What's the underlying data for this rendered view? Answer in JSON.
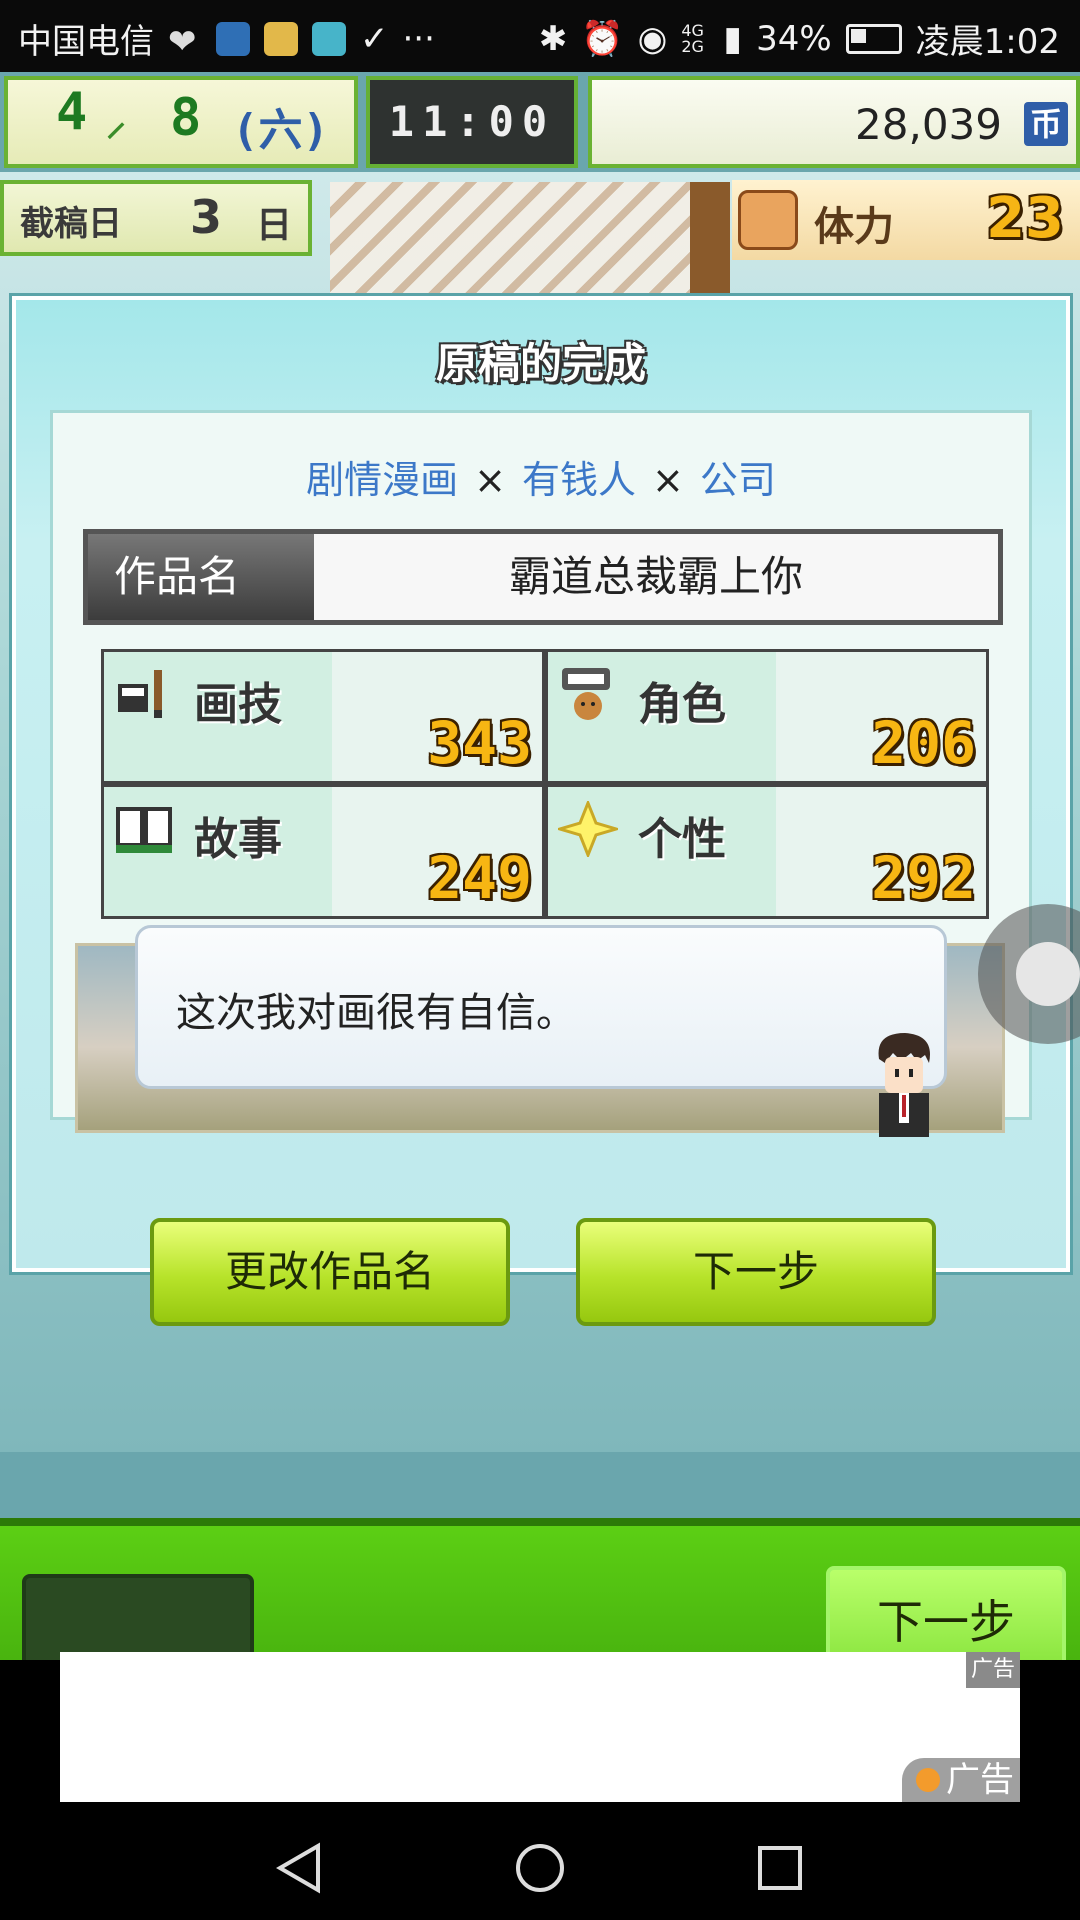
{
  "status_bar": {
    "carrier": "中国电信",
    "icons_left": [
      "heart-icon",
      "qq-icon",
      "star-app-icon",
      "news-app-icon",
      "check-icon",
      "more-dots-icon"
    ],
    "icons_right": [
      "bluetooth-icon",
      "alarm-icon",
      "eye-icon",
      "signal-icon"
    ],
    "network": "4G 2G",
    "battery": "34%",
    "time": "凌晨1:02"
  },
  "hud": {
    "date": {
      "month": "4",
      "week": "8",
      "weekday": "(六)"
    },
    "clock": "11:00",
    "money": "28,039",
    "money_unit": "币",
    "deadline": {
      "label": "截稿日",
      "days": "3",
      "unit": "日"
    },
    "stamina": {
      "label": "体力",
      "value": "23"
    }
  },
  "dialog": {
    "title": "原稿的完成",
    "genres": [
      "剧情漫画",
      "有钱人",
      "公司"
    ],
    "times_symbol": "×",
    "work_name_label": "作品名",
    "work_name_value": "霸道总裁霸上你",
    "stats": [
      {
        "label": "画技",
        "value": "343",
        "icon": "pen-ink-icon"
      },
      {
        "label": "角色",
        "value": "206",
        "icon": "character-speech-icon"
      },
      {
        "label": "故事",
        "value": "249",
        "icon": "open-book-icon"
      },
      {
        "label": "个性",
        "value": "292",
        "icon": "sparkle-icon"
      }
    ],
    "speech": "这次我对画很有自信。",
    "buttons": {
      "rename": "更改作品名",
      "next": "下一步"
    }
  },
  "bottom_bar": {
    "next": "下一步"
  },
  "ad": {
    "tag_top": "广告",
    "tag_bottom": "广告"
  },
  "colors": {
    "accent_green": "#8fd32a",
    "dialog_bg": "#bfe9ec",
    "stat_number": "#f7b613",
    "genre_text": "#3c78c8"
  }
}
